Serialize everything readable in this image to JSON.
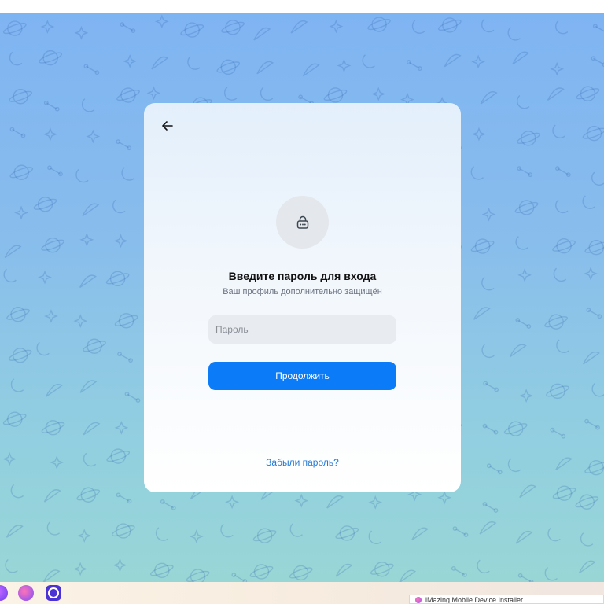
{
  "colors": {
    "accent": "#0c7bf8",
    "link": "#2479d6",
    "background_top": "#7fb4f2",
    "background_bottom": "#98d6d6"
  },
  "login": {
    "back_icon": "arrow-left-icon",
    "lock_icon": "lock-icon",
    "title": "Введите пароль для входа",
    "subtitle": "Ваш профиль дополнительно защищён",
    "password_placeholder": "Пароль",
    "password_value": "",
    "continue_label": "Продолжить",
    "forgot_label": "Забыли пароль?"
  },
  "taskbar": {
    "apps": [
      "app-icon",
      "app-icon",
      "app-icon"
    ],
    "window_title": "iMazing Mobile Device Installer"
  }
}
